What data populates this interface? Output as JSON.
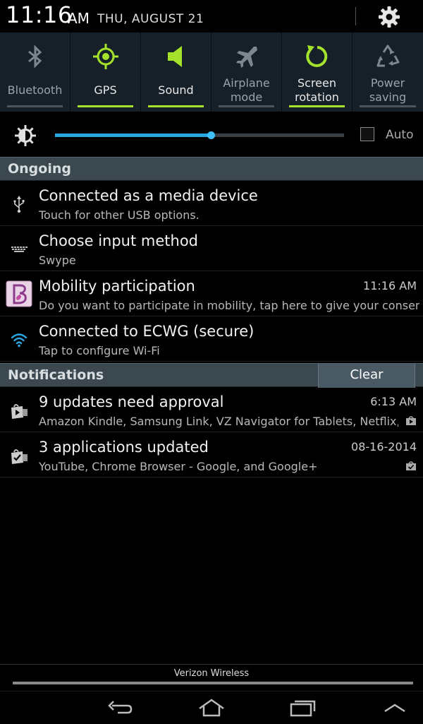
{
  "status_bar": {
    "time": "11:16",
    "ampm": "AM",
    "date": "THU, AUGUST 21",
    "settings_icon": "gear-icon"
  },
  "quick_toggles": [
    {
      "label": "Bluetooth",
      "icon": "bluetooth-icon",
      "enabled": false
    },
    {
      "label": "GPS",
      "icon": "gps-icon",
      "enabled": true
    },
    {
      "label": "Sound",
      "icon": "speaker-icon",
      "enabled": true
    },
    {
      "label": "Airplane\nmode",
      "icon": "airplane-icon",
      "enabled": false
    },
    {
      "label": "Screen\nrotation",
      "icon": "rotation-icon",
      "enabled": true
    },
    {
      "label": "Power\nsaving",
      "icon": "recycle-icon",
      "enabled": false
    }
  ],
  "brightness": {
    "level_fraction": 0.54,
    "auto_label": "Auto",
    "auto_checked": false
  },
  "ongoing": {
    "header": "Ongoing",
    "items": [
      {
        "title": "Connected as a media device",
        "subtitle": "Touch for other USB options.",
        "time": "",
        "icon": "usb-icon"
      },
      {
        "title": "Choose input method",
        "subtitle": "Swype",
        "time": "",
        "icon": "keyboard-icon"
      },
      {
        "title": "Mobility participation",
        "subtitle": "Do you want to participate in mobility, tap here to give your consent.",
        "time": "11:16 AM",
        "icon": "mobility-app-icon"
      },
      {
        "title": "Connected to ECWG (secure)",
        "subtitle": "Tap to configure Wi-Fi",
        "time": "",
        "icon": "wifi-icon"
      }
    ]
  },
  "notifications": {
    "header": "Notifications",
    "clear_label": "Clear",
    "items": [
      {
        "title": "9 updates need approval",
        "subtitle": "Amazon Kindle, Samsung Link, VZ Navigator for Tablets, Netflix, and",
        "time": "6:13 AM",
        "icon": "app-update-icon"
      },
      {
        "title": "3 applications updated",
        "subtitle": "YouTube, Chrome Browser - Google, and Google+",
        "time": "08-16-2014",
        "icon": "app-updated-icon"
      }
    ]
  },
  "carrier": "Verizon Wireless",
  "nav": {
    "back_icon": "back-icon",
    "home_icon": "home-icon",
    "recent_icon": "recent-apps-icon",
    "up_icon": "chevron-up-icon"
  },
  "colors": {
    "accent_green": "#a4e22b",
    "slider_blue": "#29a8e0",
    "toggle_bg": "#162028",
    "header_bg": "#3b4850"
  }
}
